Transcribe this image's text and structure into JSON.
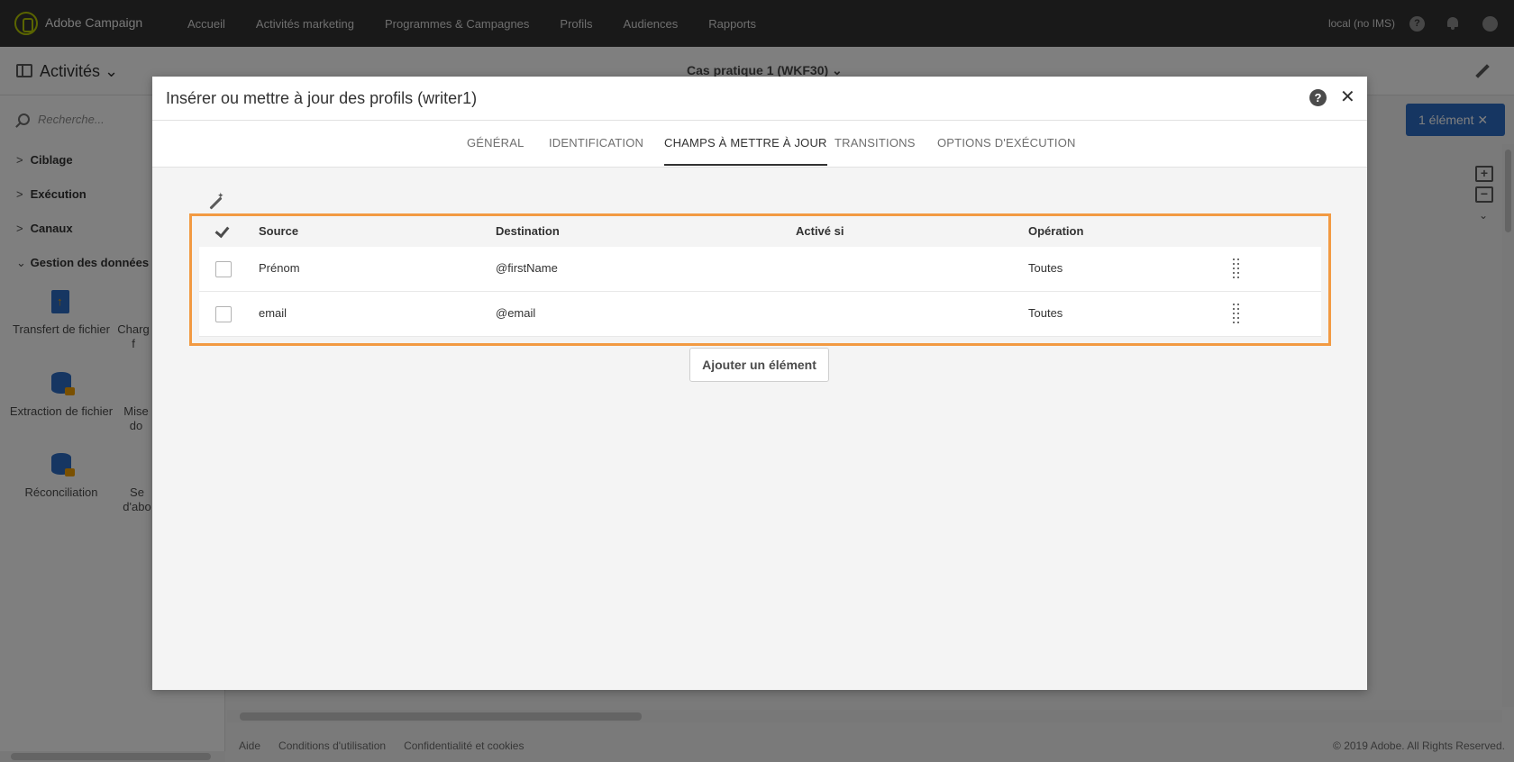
{
  "topbar": {
    "app_title": "Adobe Campaign",
    "nav": [
      "Accueil",
      "Activités marketing",
      "Programmes & Campagnes",
      "Profils",
      "Audiences",
      "Rapports"
    ],
    "user": "local (no IMS)",
    "help_glyph": "?"
  },
  "subheader": {
    "activites_label": "Activités",
    "activites_chevron": "⌄",
    "workflow_title": "Cas pratique 1 (WKF30)",
    "workflow_chevron": "⌄"
  },
  "sidebar": {
    "search_placeholder": "Recherche...",
    "categories": [
      {
        "label": "Ciblage",
        "chevron": ">"
      },
      {
        "label": "Exécution",
        "chevron": ">"
      },
      {
        "label": "Canaux",
        "chevron": ">"
      },
      {
        "label": "Gestion des données (ET",
        "chevron": "⌄"
      }
    ],
    "tiles": [
      {
        "label": "Transfert de fichier",
        "icon": "file-transfer-icon"
      },
      {
        "label": "Charg f",
        "icon": "file-load-icon"
      },
      {
        "label": "Extraction de fichier",
        "icon": "file-extraction-icon"
      },
      {
        "label": "Mise do",
        "icon": "update-data-icon"
      },
      {
        "label": "Réconciliation",
        "icon": "reconciliation-icon"
      },
      {
        "label": "Se d'abo",
        "icon": "subscription-icon"
      }
    ]
  },
  "canvas": {
    "element_button": "1 élément",
    "element_close_glyph": "✕",
    "zoom_in_glyph": "+",
    "zoom_out_glyph": "−",
    "zoom_more_glyph": "⌄"
  },
  "footer": {
    "links": [
      "Aide",
      "Conditions d'utilisation",
      "Confidentialité et cookies"
    ],
    "copyright": "© 2019 Adobe. All Rights Reserved."
  },
  "modal": {
    "title": "Insérer ou mettre à jour des profils (writer1)",
    "help_glyph": "?",
    "close_glyph": "✕",
    "tabs": [
      "GÉNÉRAL",
      "IDENTIFICATION",
      "CHAMPS À METTRE À JOUR",
      "TRANSITIONS",
      "OPTIONS D'EXÉCUTION"
    ],
    "active_tab": "CHAMPS À METTRE À JOUR",
    "columns": [
      "Source",
      "Destination",
      "Activé si",
      "Opération"
    ],
    "rows": [
      {
        "source": "Prénom",
        "destination": "@firstName",
        "enabled_if": "",
        "operation": "Toutes"
      },
      {
        "source": "email",
        "destination": "@email",
        "enabled_if": "",
        "operation": "Toutes"
      }
    ],
    "add_button": "Ajouter un élément"
  },
  "colors": {
    "topbar": "#323232",
    "accent_blue": "#2d6cc4",
    "highlight_orange": "#f29a42",
    "logo_green": "#b5c900"
  }
}
